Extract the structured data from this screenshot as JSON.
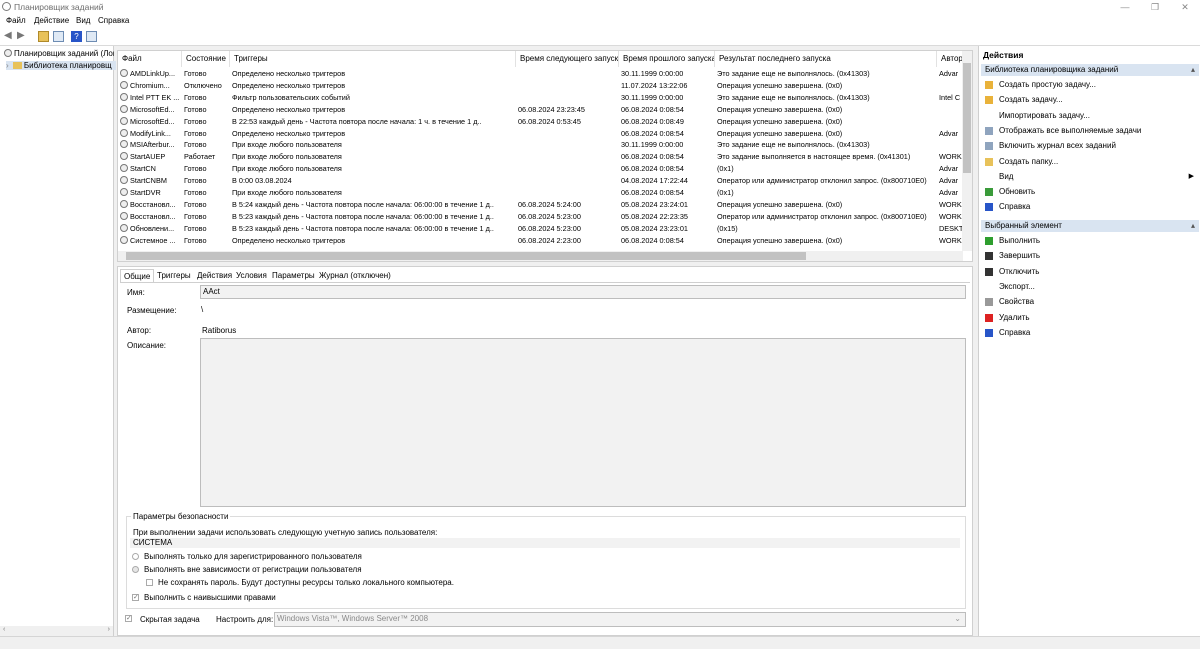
{
  "window": {
    "title": "Планировщик заданий"
  },
  "menu": [
    "Файл",
    "Действие",
    "Вид",
    "Справка"
  ],
  "tree": {
    "root": "Планировщик заданий (Лок",
    "library": "Библиотека планировщ"
  },
  "columns": [
    "Файл",
    "Состояние",
    "Триггеры",
    "Время следующего запуска",
    "Время прошлого запуска",
    "Результат последнего запуска",
    "Автор"
  ],
  "rows": [
    [
      "AMDLinkUp...",
      "Готово",
      "Определено несколько триггеров",
      "",
      "30.11.1999 0:00:00",
      "Это задание еще не выполнялось. (0x41303)",
      "Advar"
    ],
    [
      "Chromium...",
      "Отключено",
      "Определено несколько триггеров",
      "",
      "11.07.2024 13:22:06",
      "Операция успешно завершена. (0x0)",
      ""
    ],
    [
      "Intel PTT EK ...",
      "Готово",
      "Фильтр пользовательских событий",
      "",
      "30.11.1999 0:00:00",
      "Это задание еще не выполнялось. (0x41303)",
      "Intel C"
    ],
    [
      "MicrosoftEd...",
      "Готово",
      "Определено несколько триггеров",
      "06.08.2024 23:23:45",
      "06.08.2024 0:08:54",
      "Операция успешно завершена. (0x0)",
      ""
    ],
    [
      "MicrosoftEd...",
      "Готово",
      "В 22:53 каждый день - Частота повтора после начала: 1 ч. в течение 1 д..",
      "06.08.2024 0:53:45",
      "06.08.2024 0:08:49",
      "Операция успешно завершена. (0x0)",
      ""
    ],
    [
      "ModifyLink...",
      "Готово",
      "Определено несколько триггеров",
      "",
      "06.08.2024 0:08:54",
      "Операция успешно завершена. (0x0)",
      "Advar"
    ],
    [
      "MSIAfterbur...",
      "Готово",
      "При входе любого пользователя",
      "",
      "30.11.1999 0:00:00",
      "Это задание еще не выполнялось. (0x41303)",
      ""
    ],
    [
      "StartAUEP",
      "Работает",
      "При входе любого пользователя",
      "",
      "06.08.2024 0:08:54",
      "Это задание выполняется в настоящее время. (0x41301)",
      "WORK"
    ],
    [
      "StartCN",
      "Готово",
      "При входе любого пользователя",
      "",
      "06.08.2024 0:08:54",
      "(0x1)",
      "Advar"
    ],
    [
      "StartCNBM",
      "Готово",
      "В 0:00 03.08.2024",
      "",
      "04.08.2024 17:22:44",
      "Оператор или администратор отклонил запрос. (0x800710E0)",
      "Advar"
    ],
    [
      "StartDVR",
      "Готово",
      "При входе любого пользователя",
      "",
      "06.08.2024 0:08:54",
      "(0x1)",
      "Advar"
    ],
    [
      "Восстановл...",
      "Готово",
      "В 5:24 каждый день - Частота повтора после начала: 06:00:00 в течение 1 д..",
      "06.08.2024 5:24:00",
      "05.08.2024 23:24:01",
      "Операция успешно завершена. (0x0)",
      "WORK"
    ],
    [
      "Восстановл...",
      "Готово",
      "В 5:23 каждый день - Частота повтора после начала: 06:00:00 в течение 1 д..",
      "06.08.2024 5:23:00",
      "05.08.2024 22:23:35",
      "Оператор или администратор отклонил запрос. (0x800710E0)",
      "WORK"
    ],
    [
      "Обновлени...",
      "Готово",
      "В 5:23 каждый день - Частота повтора после начала: 06:00:00 в течение 1 д..",
      "06.08.2024 5:23:00",
      "05.08.2024 23:23:01",
      "(0x15)",
      "DESKT"
    ],
    [
      "Системное ...",
      "Готово",
      "Определено несколько триггеров",
      "06.08.2024 2:23:00",
      "06.08.2024 0:08:54",
      "Операция успешно завершена. (0x0)",
      "WORK"
    ]
  ],
  "tabs": [
    "Общие",
    "Триггеры",
    "Действия",
    "Условия",
    "Параметры",
    "Журнал (отключен)"
  ],
  "general": {
    "name_label": "Имя:",
    "name_value": "AAct",
    "location_label": "Размещение:",
    "location_value": "\\",
    "author_label": "Автор:",
    "author_value": "Ratiborus",
    "description_label": "Описание:",
    "security_title": "Параметры безопасности",
    "account_prompt": "При выполнении задачи использовать следующую учетную запись пользователя:",
    "account_value": "СИСТЕМА",
    "radio1": "Выполнять только для зарегистрированного пользователя",
    "radio2": "Выполнять вне зависимости от регистрации пользователя",
    "nopass": "Не сохранять пароль. Будут доступны ресурсы только локального компьютера.",
    "highest": "Выполнить с наивысшими правами",
    "hidden": "Скрытая задача",
    "configure_label": "Настроить для:",
    "configure_value": "Windows Vista™, Windows Server™ 2008"
  },
  "actions": {
    "title": "Действия",
    "section1": "Библиотека планировщика заданий",
    "items1": [
      "Создать простую задачу...",
      "Создать задачу...",
      "Импортировать задачу...",
      "Отображать все выполняемые задачи",
      "Включить журнал всех заданий",
      "Создать папку...",
      "Вид",
      "Обновить",
      "Справка"
    ],
    "section2": "Выбранный элемент",
    "items2": [
      "Выполнить",
      "Завершить",
      "Отключить",
      "Экспорт...",
      "Свойства",
      "Удалить",
      "Справка"
    ]
  },
  "colors": {
    "accent": "#d9e4f1",
    "run": "#2e9e2e",
    "delete": "#d22",
    "help": "#2855c8"
  }
}
